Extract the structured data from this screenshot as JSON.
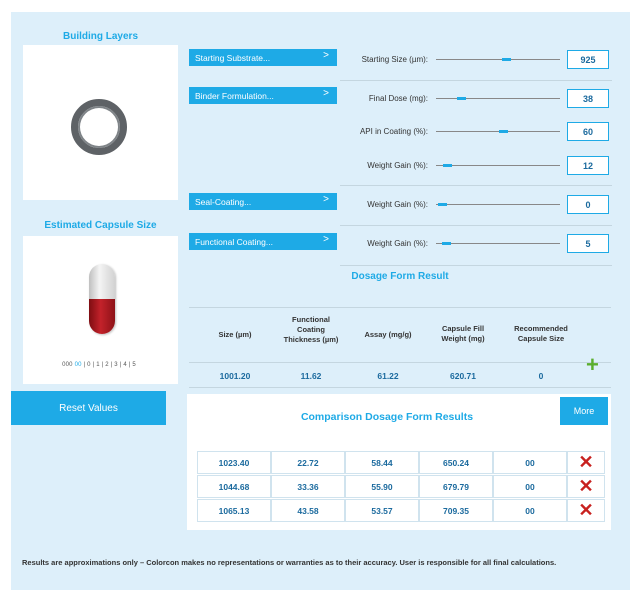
{
  "building_layers": {
    "title": "Building Layers"
  },
  "capsule": {
    "title": "Estimated Capsule Size",
    "sizes": [
      "000",
      "00",
      "0",
      "1",
      "2",
      "3",
      "4",
      "5"
    ],
    "selected": "00"
  },
  "reset_label": "Reset Values",
  "layers": [
    {
      "button": "Starting Substrate...",
      "chevron": ">",
      "rows": [
        {
          "label": "Starting Size (µm):",
          "value": "925",
          "level": 0.57
        }
      ]
    },
    {
      "button": "Binder Formulation...",
      "chevron": ">",
      "rows": [
        {
          "label": "Final Dose (mg):",
          "value": "38",
          "level": 0.18
        },
        {
          "label": "API in Coating (%):",
          "value": "60",
          "level": 0.55
        },
        {
          "label": "Weight Gain (%):",
          "value": "12",
          "level": 0.06
        }
      ]
    },
    {
      "button": "Seal-Coating...",
      "chevron": ">",
      "rows": [
        {
          "label": "Weight Gain (%):",
          "value": "0",
          "level": 0.02
        }
      ]
    },
    {
      "button": "Functional Coating...",
      "chevron": ">",
      "rows": [
        {
          "label": "Weight Gain (%):",
          "value": "5",
          "level": 0.05
        }
      ]
    }
  ],
  "dosage_result": {
    "title": "Dosage Form Result",
    "headers": [
      "Size (µm)",
      "Functional Coating Thickness (µm)",
      "Assay (mg/g)",
      "Capsule Fill Weight (mg)",
      "Recommended Capsule Size"
    ],
    "values": [
      "1001.20",
      "11.62",
      "61.22",
      "620.71",
      "0"
    ],
    "add_icon": "plus-icon"
  },
  "comparison": {
    "title": "Comparison Dosage Form Results",
    "more_label": "More",
    "rows": [
      [
        "1023.40",
        "22.72",
        "58.44",
        "650.24",
        "00"
      ],
      [
        "1044.68",
        "33.36",
        "55.90",
        "679.79",
        "00"
      ],
      [
        "1065.13",
        "43.58",
        "53.57",
        "709.35",
        "00"
      ]
    ],
    "remove_icon": "close-icon"
  },
  "disclaimer": "Results are approximations only – Colorcon makes no representations or warranties as to their accuracy. User is responsible for all final calculations.",
  "colors": {
    "accent": "#1eaae6",
    "background": "#ddeffa",
    "value_text": "#1b6a9e",
    "add": "#5aae2d",
    "remove": "#c8211f"
  }
}
